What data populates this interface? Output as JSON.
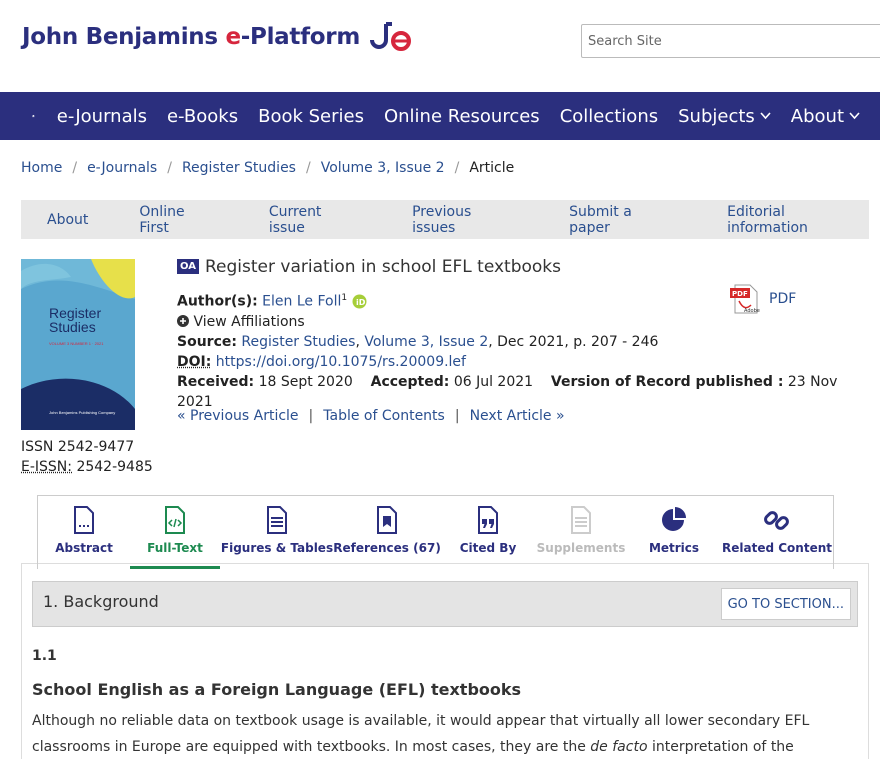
{
  "header": {
    "logo_text_1": "John Benjamins ",
    "logo_text_e": "e",
    "logo_text_2": "-Platform",
    "logo_mark": "jbe",
    "search_placeholder": "Search Site",
    "brand_color": "#2b2f7e",
    "accent_color": "#d6263d"
  },
  "nav": {
    "items": [
      "e-Journals",
      "e-Books",
      "Book Series",
      "Online Resources",
      "Collections",
      "Subjects",
      "About"
    ]
  },
  "breadcrumb": [
    "Home",
    "e-Journals",
    "Register Studies",
    "Volume 3, Issue 2",
    "Article"
  ],
  "journal_nav": [
    "About",
    "Online First",
    "Current issue",
    "Previous issues",
    "Submit a paper",
    "Editorial information"
  ],
  "cover": {
    "title_line1": "Register",
    "title_line2": "Studies",
    "subline": "VOLUME 3 NUMBER 1 · 2021",
    "publisher": "John Benjamins Publishing Company"
  },
  "issn": {
    "issn_label": "ISSN",
    "issn": "2542-9477",
    "eissn_label": "E-ISSN:",
    "eissn": "2542-9485"
  },
  "article": {
    "oa_badge": "OA",
    "title": "Register variation in school EFL textbooks",
    "authors_label": "Author(s):",
    "author": "Elen Le Foll",
    "author_sup": "1",
    "affiliations": "View Affiliations",
    "source_label": "Source:",
    "source_journal": "Register Studies",
    "source_issue": "Volume 3, Issue 2",
    "source_rest": ", Dec 2021, p. 207 - 246",
    "doi_label": "DOI:",
    "doi": "https://doi.org/10.1075/rs.20009.lef",
    "received_label": "Received:",
    "received": "18 Sept 2020",
    "accepted_label": "Accepted:",
    "accepted": "06 Jul 2021",
    "vor_label": "Version of Record published :",
    "vor": "23 Nov 2021",
    "pdf_label": "PDF",
    "prev": "« Previous Article",
    "toc": "Table of Contents",
    "next": "Next Article »"
  },
  "tabs": [
    {
      "label": "Abstract",
      "icon": "abstract-icon",
      "state": "normal"
    },
    {
      "label": "Full-Text",
      "icon": "fulltext-icon",
      "state": "active"
    },
    {
      "label": "Figures & Tables",
      "icon": "figures-icon",
      "state": "normal"
    },
    {
      "label": "References (67)",
      "icon": "references-icon",
      "state": "normal"
    },
    {
      "label": "Cited By",
      "icon": "cited-by-icon",
      "state": "normal"
    },
    {
      "label": "Supplements",
      "icon": "supplements-icon",
      "state": "disabled"
    },
    {
      "label": "Metrics",
      "icon": "metrics-icon",
      "state": "normal"
    },
    {
      "label": "Related Content",
      "icon": "related-content-icon",
      "state": "normal"
    }
  ],
  "content": {
    "section_heading": "1. Background",
    "goto_label": "GO TO SECTION...",
    "subsection_number": "1.1",
    "subsection_title": "School English as a Foreign Language (EFL) textbooks",
    "para_1": "Although no reliable data on textbook usage is available, it would appear that virtually all lower secondary EFL classrooms in Europe are equipped with textbooks. In most cases, they are the ",
    "para_italic": "de facto",
    "para_2": " interpretation of the curriculum"
  }
}
